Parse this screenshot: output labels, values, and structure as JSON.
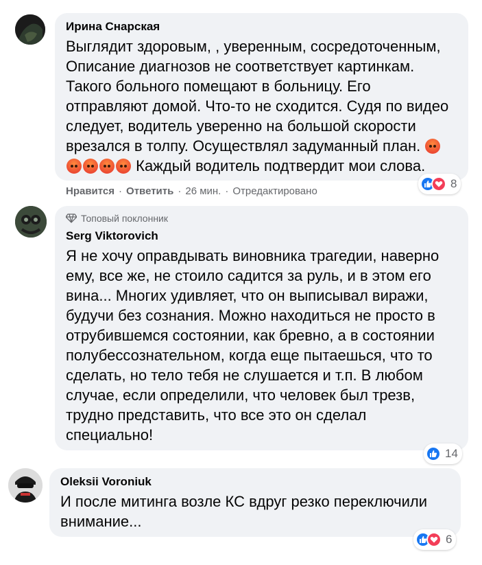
{
  "colors": {
    "bubble": "#f0f2f5",
    "like": "#1877f2",
    "love": "#f33e58",
    "meta": "#65676b",
    "angry": "#ec4b33"
  },
  "comments": [
    {
      "author": "Ирина Снарская",
      "lines": [
        "Выглядит здоровым, , уверенным, сосредоточенным,",
        "Описание диагнозов не соответствует картинкам.",
        "Такого больного помещают в больницу. Его",
        "отправляют домой. Что-то не сходится. Судя по видео",
        "следует, водитель уверенно на большой скорости",
        "врезался в толпу. Осуществлял задуманный план."
      ],
      "last_line": "Каждый водитель подтвердит мои слова.",
      "emoji": "angry-face-emoji",
      "actions": {
        "like": "Нравится",
        "reply": "Ответить",
        "time": "26 мин.",
        "edited": "Отредактировано",
        "sep": "·"
      },
      "reactions": {
        "icons": [
          "like-icon",
          "love-icon"
        ],
        "count": "8"
      }
    },
    {
      "badge": "Топовый поклонник",
      "author": "Serg Viktorovich",
      "lines": [
        "Я не хочу оправдывать виновника трагедии, наверно",
        "ему, все же, не стоило садится за руль, и в этом его",
        "вина... Многих удивляет, что он выписывал виражи,",
        "будучи без сознания. Можно находиться не просто в",
        "отрубившемся состоянии, как бревно, а в состоянии",
        "полубессознательном, когда еще пытаешься, что то",
        "сделать, но тело тебя не слушается и т.п. В любом",
        "случае, если определили, что человек был трезв,",
        "трудно представить, что все это он сделал",
        "специально!"
      ],
      "reactions": {
        "icons": [
          "like-icon"
        ],
        "count": "14"
      }
    },
    {
      "author": "Oleksii Voroniuk",
      "lines": [
        "И после митинга возле КС вдруг резко переключили",
        "внимание..."
      ],
      "reactions": {
        "icons": [
          "like-icon",
          "love-icon"
        ],
        "count": "6"
      }
    }
  ]
}
